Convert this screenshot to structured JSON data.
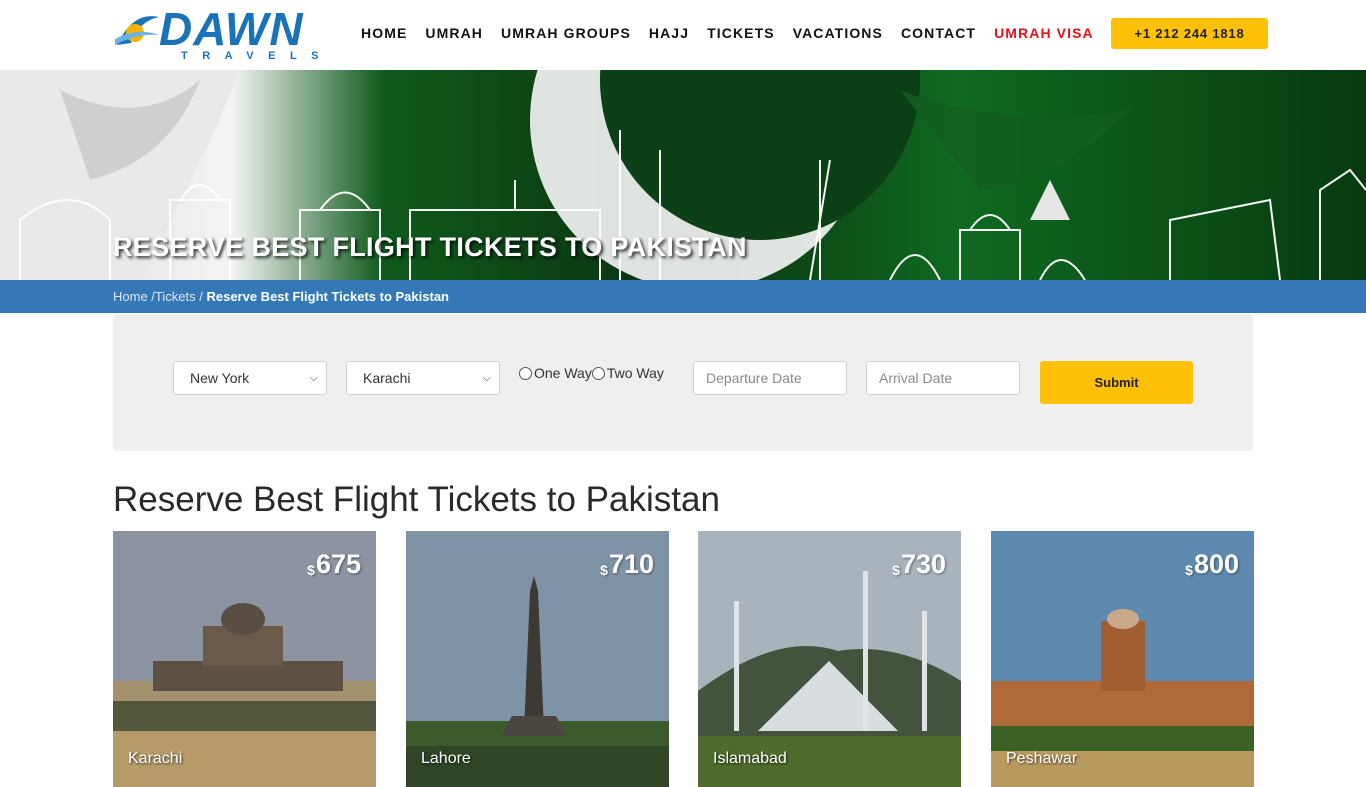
{
  "brand": {
    "name": "DAWN",
    "tagline": "TRAVELS"
  },
  "nav": {
    "items": [
      "HOME",
      "UMRAH",
      "UMRAH GROUPS",
      "HAJJ",
      "TICKETS",
      "VACATIONS",
      "CONTACT",
      "UMRAH VISA"
    ],
    "highlight_color": "#e0141e",
    "phone": "+1 212 244 1818"
  },
  "hero": {
    "title": "RESERVE BEST FLIGHT TICKETS TO PAKISTAN"
  },
  "breadcrumb": {
    "home": "Home",
    "sep1": " /",
    "tickets": "Tickets",
    "sep2": " / ",
    "current": "Reserve Best Flight Tickets to Pakistan"
  },
  "search": {
    "from": "New York",
    "to": "Karachi",
    "trip_one": "One Way",
    "trip_two": "Two Way",
    "departure_placeholder": "Departure Date",
    "arrival_placeholder": "Arrival Date",
    "submit": "Submit"
  },
  "section": {
    "title": "Reserve Best Flight Tickets to Pakistan"
  },
  "cards": [
    {
      "city": "Karachi",
      "currency": "$",
      "price": "675"
    },
    {
      "city": "Lahore",
      "currency": "$",
      "price": "710"
    },
    {
      "city": "Islamabad",
      "currency": "$",
      "price": "730"
    },
    {
      "city": "Peshawar",
      "currency": "$",
      "price": "800"
    }
  ],
  "colors": {
    "accent": "#ffc107",
    "brand_blue": "#1a73b8",
    "breadcrumb_bar": "#3478b6"
  }
}
